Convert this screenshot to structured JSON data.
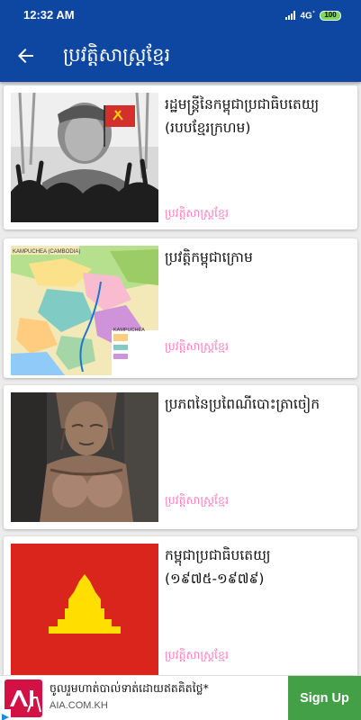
{
  "status_bar": {
    "time": "12:32 AM",
    "network": "4G",
    "battery": "100"
  },
  "app_bar": {
    "title": "ប្រវត្តិសាស្ត្រខ្មែរ",
    "back_icon": "arrow-left-icon"
  },
  "articles": [
    {
      "title": "រដ្ឋមន្ត្រីនៃកម្ពុជាប្រជាធិបតេយ្យ (របបខ្មែរក្រហម)",
      "category": "ប្រវត្តិសាស្ត្រខ្មែរ",
      "image": "portrait-with-crowd-and-red-flag"
    },
    {
      "title": "ប្រវត្តិកម្ពុជាក្រោម",
      "category": "ប្រវត្តិសាស្ត្រខ្មែរ",
      "image": "map-kampuchea-krom",
      "map_label_top": "KAMPUCHEA (CAMBODIA)",
      "map_label_bottom": "KAMPUCHEA"
    },
    {
      "title": "ប្រភពនៃប្រពៃណីបោះត្រាចៀក",
      "category": "ប្រវត្តិសាស្ត្រខ្មែរ",
      "image": "stone-carving-apsara"
    },
    {
      "title": "កម្ពុជាប្រជាធិបតេយ្យ (១៩៧៥-១៩៧៩)",
      "category": "ប្រវត្តិសាស្ត្រខ្មែរ",
      "image": "democratic-kampuchea-flag"
    }
  ],
  "ad": {
    "logo_text": "AIA",
    "headline": "ចូលរួមហាត់បាល់ទាត់ដោយឥតគិតថ្លៃ*",
    "url": "AIA.COM.KH",
    "cta": "Sign Up"
  },
  "colors": {
    "primary": "#0d47a1",
    "category_pink": "#ff80c0",
    "cta_green": "#43a047",
    "aia_red": "#d31145"
  }
}
